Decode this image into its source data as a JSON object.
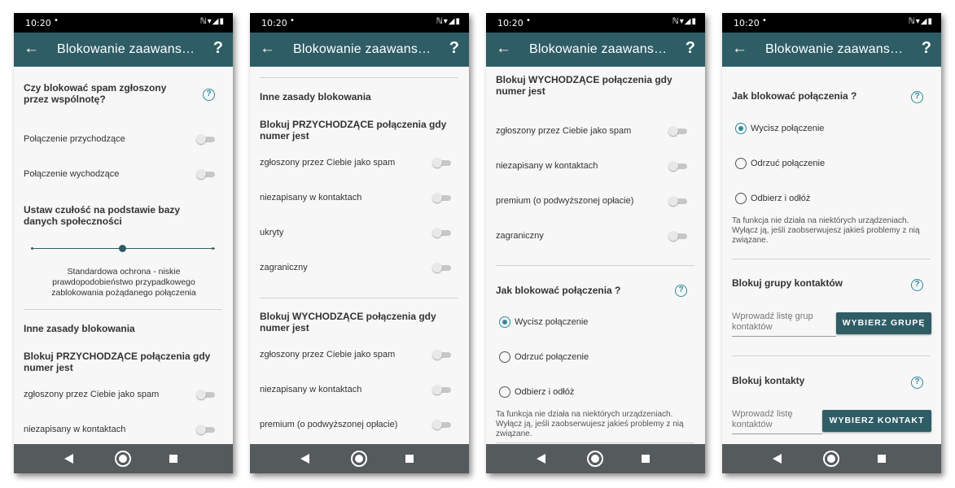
{
  "app": {
    "title": "Blokowanie zaawansowane",
    "accent_color": "#2f5d66",
    "help_color": "#2f8a9a"
  },
  "status": {
    "time": "10:20",
    "dot": "•",
    "icons": "ℕ▾◢▮"
  },
  "appbar": {
    "back_icon": "←",
    "help_icon": "?"
  },
  "help_glyph": "?",
  "texts": {
    "spam_question": "Czy blokować spam zgłoszony przez wspólnotę?",
    "incoming_call": "Połączenie przychodzące",
    "outgoing_call": "Połączenie wychodzące",
    "sensitivity_heading": "Ustaw czułość na podstawie bazy danych społeczności",
    "sensitivity_desc": "Standardowa ochrona - niskie prawdopodobieństwo przypadkowego zablokowania pożądanego połączenia",
    "other_rules": "Inne zasady blokowania",
    "block_incoming": "Blokuj PRZYCHODZĄCE połączenia gdy numer jest",
    "block_outgoing": "Blokuj WYCHODZĄCE połączenia gdy numer jest",
    "reported_spam": "zgłoszony przez Ciebie jako spam",
    "not_in_contacts": "niezapisany w kontaktach",
    "hidden": "ukryty",
    "foreign": "zagraniczny",
    "premium": "premium (o podwyższonej opłacie)",
    "how_block": "Jak blokować połączenia ?",
    "mute": "Wycisz połączenie",
    "reject": "Odrzuć połączenie",
    "answer_hangup": "Odbierz i odłóż",
    "device_note": "Ta funkcja nie działa na niektórych urządzeniach. Wyłącz ją, jeśli zaobserwujesz jakieś problemy z nią związane.",
    "block_groups": "Blokuj grupy kontaktów",
    "groups_placeholder": "Wprowadź listę grup kontaktów",
    "choose_group": "WYBIERZ GRUPĘ",
    "block_contacts": "Blokuj kontakty",
    "contacts_placeholder": "Wprowadź listę kontaktów",
    "choose_contact": "WYBIERZ KONTAKT"
  },
  "settings": {
    "incoming_call_on": false,
    "outgoing_call_on": false,
    "sensitivity_level": 0.5,
    "call_action": "Wycisz połączenie"
  }
}
